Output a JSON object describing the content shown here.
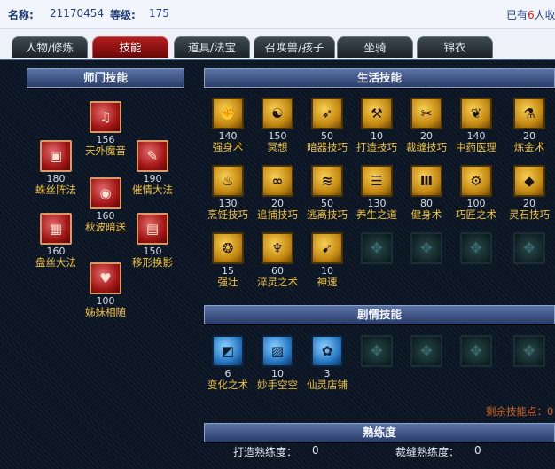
{
  "topbar": {
    "name_label": "名称:",
    "name_value": "21170454",
    "level_label": "等级:",
    "level_value": "175",
    "right_prefix": "已有",
    "right_num": "6",
    "right_suffix": "人收"
  },
  "tabs": [
    {
      "label": "人物/修炼",
      "active": false
    },
    {
      "label": "技能",
      "active": true
    },
    {
      "label": "道具/法宝",
      "active": false
    },
    {
      "label": "召唤兽/孩子",
      "active": false
    },
    {
      "label": "坐骑",
      "active": false
    },
    {
      "label": "锦衣",
      "active": false
    }
  ],
  "sections": {
    "school": "师门技能",
    "life": "生活技能",
    "plot": "剧情技能",
    "proficiency": "熟练度"
  },
  "school_skills": [
    {
      "name": "天外魔音",
      "value": "156",
      "icon": "red-sound-icon"
    },
    {
      "name": "蛛丝阵法",
      "value": "180",
      "icon": "red-web-icon"
    },
    {
      "name": "催情大法",
      "value": "190",
      "icon": "red-charm-icon"
    },
    {
      "name": "秋波暗送",
      "value": "160",
      "icon": "red-eye-icon"
    },
    {
      "name": "盘丝大法",
      "value": "160",
      "icon": "red-silk-icon"
    },
    {
      "name": "移形换影",
      "value": "150",
      "icon": "red-shadow-icon"
    },
    {
      "name": "姊妹相随",
      "value": "100",
      "icon": "red-heart-icon"
    }
  ],
  "life_skills": [
    {
      "name": "强身术",
      "value": "140",
      "icon": "strength-icon"
    },
    {
      "name": "冥想",
      "value": "150",
      "icon": "meditate-icon"
    },
    {
      "name": "暗器技巧",
      "value": "50",
      "icon": "dart-icon"
    },
    {
      "name": "打造技巧",
      "value": "10",
      "icon": "forge-icon"
    },
    {
      "name": "裁缝技巧",
      "value": "20",
      "icon": "scissors-icon"
    },
    {
      "name": "中药医理",
      "value": "140",
      "icon": "herb-icon"
    },
    {
      "name": "炼金术",
      "value": "20",
      "icon": "alchemy-icon"
    },
    {
      "name": "烹饪技巧",
      "value": "130",
      "icon": "cooking-icon"
    },
    {
      "name": "追捕技巧",
      "value": "20",
      "icon": "chase-icon"
    },
    {
      "name": "逃离技巧",
      "value": "50",
      "icon": "escape-icon"
    },
    {
      "name": "养生之道",
      "value": "130",
      "icon": "health-icon"
    },
    {
      "name": "健身术",
      "value": "80",
      "icon": "fitness-icon"
    },
    {
      "name": "巧匠之术",
      "value": "100",
      "icon": "craftsman-icon"
    },
    {
      "name": "灵石技巧",
      "value": "20",
      "icon": "gem-icon"
    },
    {
      "name": "强壮",
      "value": "15",
      "icon": "muscle-icon"
    },
    {
      "name": "淬灵之术",
      "value": "60",
      "icon": "temper-icon"
    },
    {
      "name": "神速",
      "value": "10",
      "icon": "speed-icon"
    }
  ],
  "plot_skills": [
    {
      "name": "变化之术",
      "value": "6",
      "icon": "transform-icon"
    },
    {
      "name": "妙手空空",
      "value": "10",
      "icon": "steal-icon"
    },
    {
      "name": "仙灵店铺",
      "value": "3",
      "icon": "shop-icon"
    }
  ],
  "remaining_points": "剩余技能点：0",
  "proficiency": {
    "forge_label": "打造熟练度：",
    "forge_value": "0",
    "tailor_label": "裁缝熟练度：",
    "tailor_value": "0"
  }
}
